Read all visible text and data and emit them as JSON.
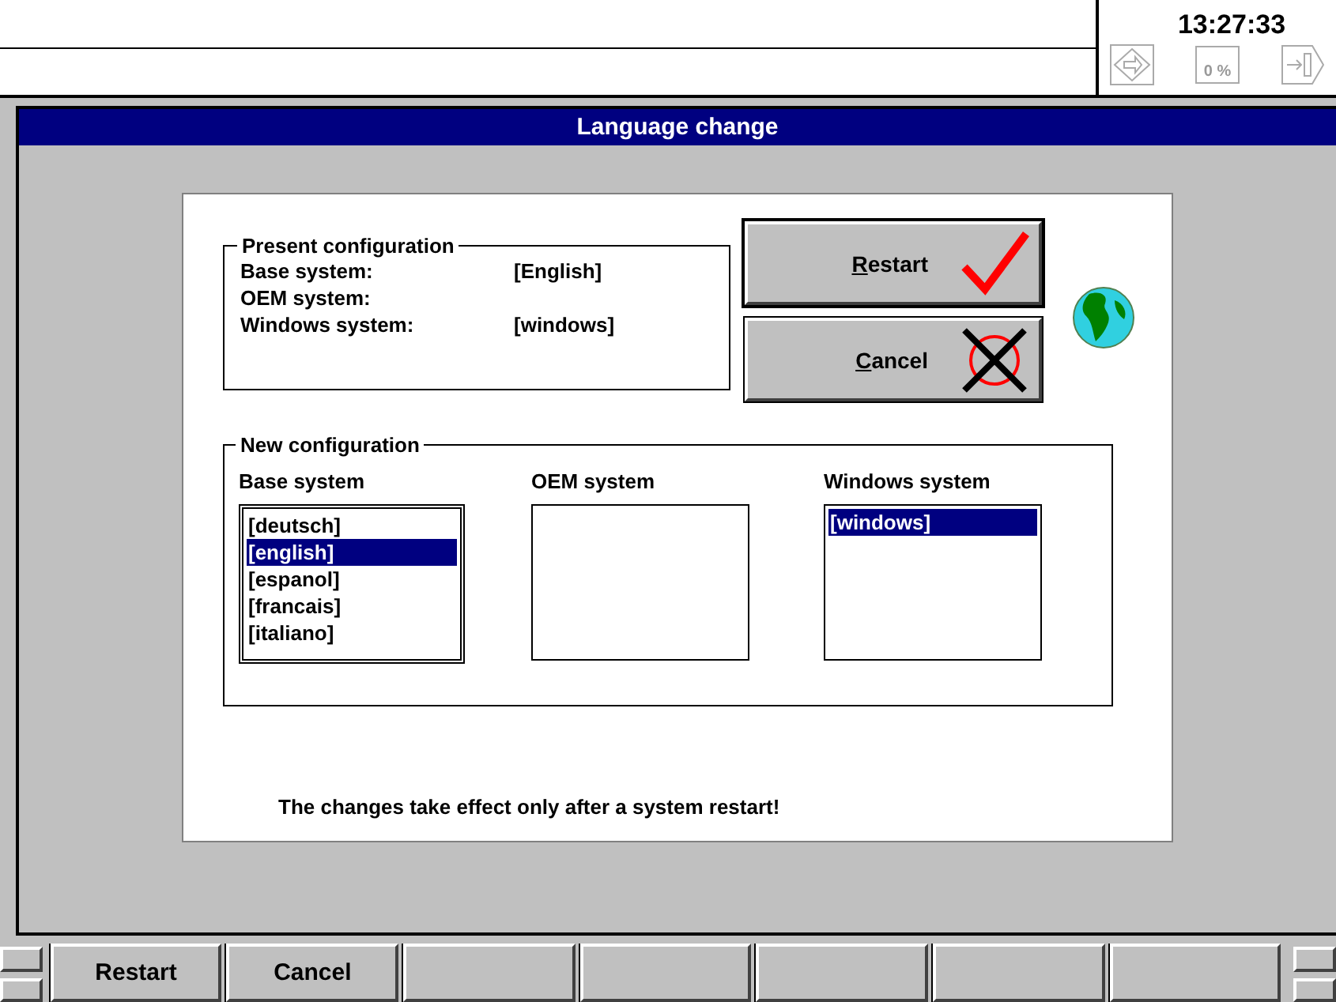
{
  "clock": "13:27:33",
  "load_label": "0 %",
  "title": "Language change",
  "present": {
    "title": "Present configuration",
    "rows": [
      {
        "label": "Base system:",
        "value": "[English]"
      },
      {
        "label": "OEM system:"
      },
      {
        "label": "Windows system:",
        "value": "[windows]"
      }
    ]
  },
  "buttons": [
    {
      "kind": "restart",
      "label": "Restart"
    },
    {
      "kind": "cancel",
      "label": "Cancel"
    }
  ],
  "new": {
    "title": "New configuration",
    "lists": [
      {
        "label": "Base system",
        "items": [
          {
            "text": "[deutsch]",
            "selected": false
          },
          {
            "text": "[english]",
            "selected": true
          },
          {
            "text": "[espanol]",
            "selected": false
          },
          {
            "text": "[francais]",
            "selected": false
          },
          {
            "text": "[italiano]",
            "selected": false
          }
        ]
      },
      {
        "label": "OEM system"
      },
      {
        "label": "Windows system",
        "items": [
          {
            "text": "[windows]",
            "selected": true
          }
        ]
      }
    ]
  },
  "note": "The changes take effect only after a system restart!",
  "softkeys": [
    "Restart",
    "Cancel"
  ]
}
